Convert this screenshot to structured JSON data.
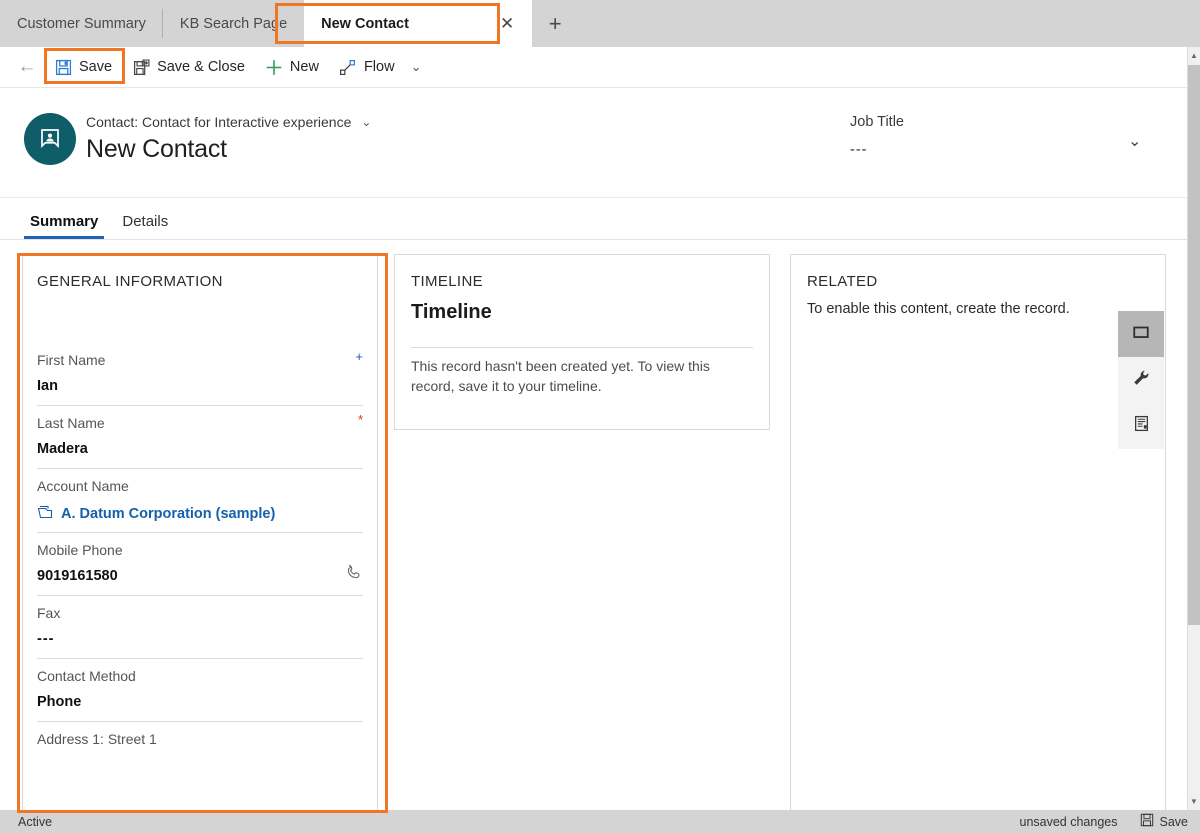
{
  "browser_tabs": [
    {
      "label": "Customer Summary",
      "active": false
    },
    {
      "label": "KB Search Page",
      "active": false
    },
    {
      "label": "New Contact",
      "active": true
    }
  ],
  "newtab_glyph": "+",
  "tab_close_glyph": "✕",
  "commandbar": {
    "back_glyph": "←",
    "buttons": [
      {
        "label": "Save",
        "icon": "save-icon"
      },
      {
        "label": "Save & Close",
        "icon": "save-and-close-icon"
      },
      {
        "label": "New",
        "icon": "plus-icon"
      },
      {
        "label": "Flow",
        "icon": "flow-icon"
      }
    ],
    "overflow_glyph": "⌄"
  },
  "record_header": {
    "entity_label": "Contact: Contact for Interactive experience",
    "entity_chevron": "⌄",
    "title": "New Contact",
    "job_title_label": "Job Title",
    "job_title_value": "---",
    "expand_chevron": "⌄"
  },
  "form_tabs": [
    {
      "label": "Summary",
      "selected": true
    },
    {
      "label": "Details",
      "selected": false
    }
  ],
  "general_information": {
    "title": "GENERAL INFORMATION",
    "fields": [
      {
        "label": "First Name",
        "value": "Ian",
        "marker": "recommended",
        "marker_glyph": "+",
        "type": "text"
      },
      {
        "label": "Last Name",
        "value": "Madera",
        "marker": "required",
        "marker_glyph": "*",
        "type": "text"
      },
      {
        "label": "Account Name",
        "value": "A. Datum Corporation (sample)",
        "marker": "none",
        "marker_glyph": "",
        "type": "lookup"
      },
      {
        "label": "Mobile Phone",
        "value": "9019161580",
        "marker": "none",
        "marker_glyph": "",
        "type": "phone"
      },
      {
        "label": "Fax",
        "value": "---",
        "marker": "none",
        "marker_glyph": "",
        "type": "text"
      },
      {
        "label": "Contact Method",
        "value": "Phone",
        "marker": "none",
        "marker_glyph": "",
        "type": "text"
      },
      {
        "label": "Address 1: Street 1",
        "value": "",
        "marker": "none",
        "marker_glyph": "",
        "type": "text"
      }
    ]
  },
  "timeline": {
    "title": "TIMELINE",
    "heading": "Timeline",
    "empty_message": "This record hasn't been created yet.  To view this record, save it to your timeline."
  },
  "related": {
    "title": "RELATED",
    "message": "To enable this content, create the record.",
    "rail": [
      {
        "icon": "folder-icon",
        "selected": true
      },
      {
        "icon": "wrench-icon",
        "selected": false
      },
      {
        "icon": "document-icon",
        "selected": false
      }
    ]
  },
  "statusbar": {
    "state": "Active",
    "unsaved": "unsaved changes",
    "save_label": "Save"
  },
  "scrollbar": {
    "up_glyph": "▲",
    "down_glyph": "▼"
  },
  "colors": {
    "accent_blue": "#1f62b8",
    "link_blue": "#1560ab",
    "avatar_teal": "#0f5d68",
    "highlight_orange": "#ef7622",
    "required_red": "#d83b01",
    "recommended_blue": "#2b50c8",
    "new_green": "#2e9e52"
  }
}
